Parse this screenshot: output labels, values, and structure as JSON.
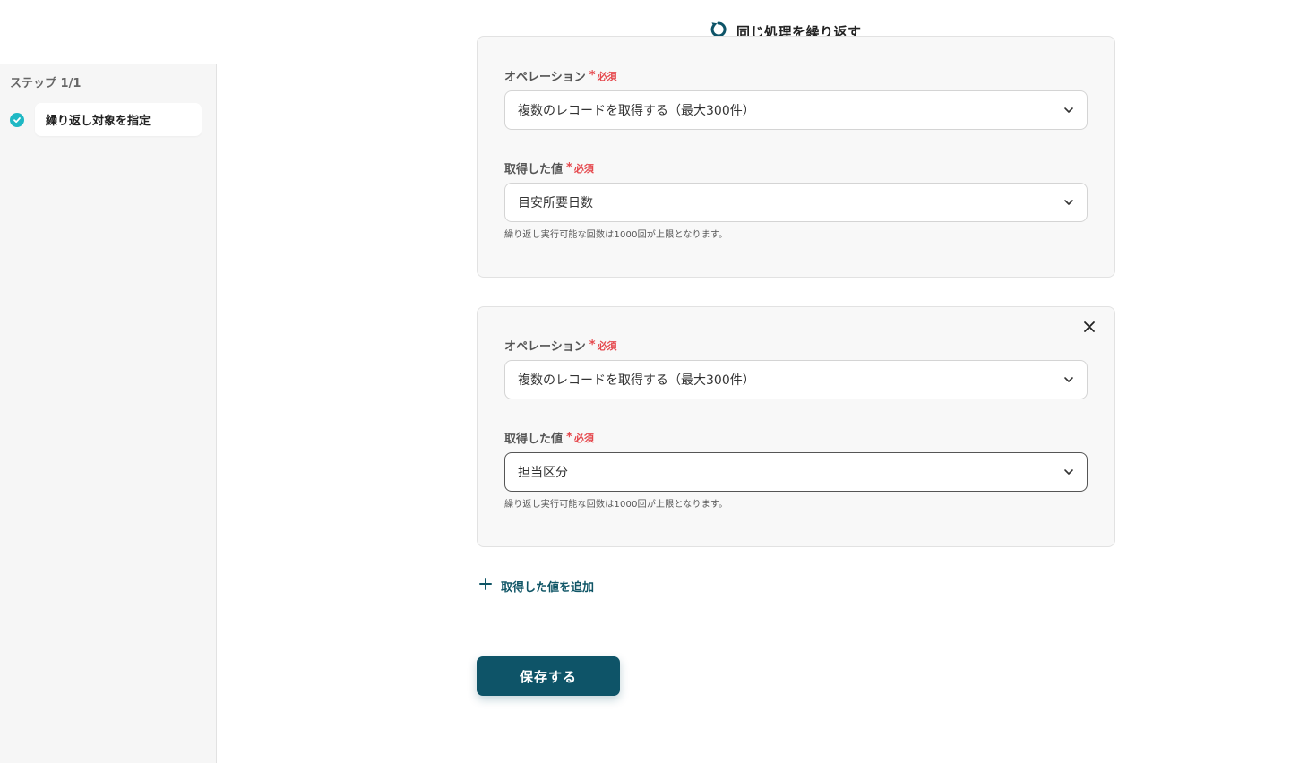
{
  "header": {
    "title": "同じ処理を繰り返す",
    "icon": "loop-icon",
    "icon_color": "#0e5468"
  },
  "sidebar": {
    "step_count": "ステップ 1/1",
    "steps": [
      {
        "label": "繰り返し対象を指定",
        "status": "complete",
        "status_color": "#1fb8c4"
      }
    ]
  },
  "blocks": [
    {
      "operation_label": "オペレーション",
      "operation_value": "複数のレコードを取得する（最大300件）",
      "value_label": "取得した値",
      "value_value": "目安所要日数",
      "required_text": "必須",
      "hint": "繰り返し実行可能な回数は1000回が上限となります。"
    },
    {
      "operation_label": "オペレーション",
      "operation_value": "複数のレコードを取得する（最大300件）",
      "value_label": "取得した値",
      "value_value": "担当区分",
      "required_text": "必須",
      "hint": "繰り返し実行可能な回数は1000回が上限となります。"
    }
  ],
  "actions": {
    "add_value_label": "取得した値を追加",
    "save_label": "保存する"
  },
  "colors": {
    "primary": "#0e5468",
    "required": "#e5484d",
    "accent": "#1fb8c4"
  }
}
